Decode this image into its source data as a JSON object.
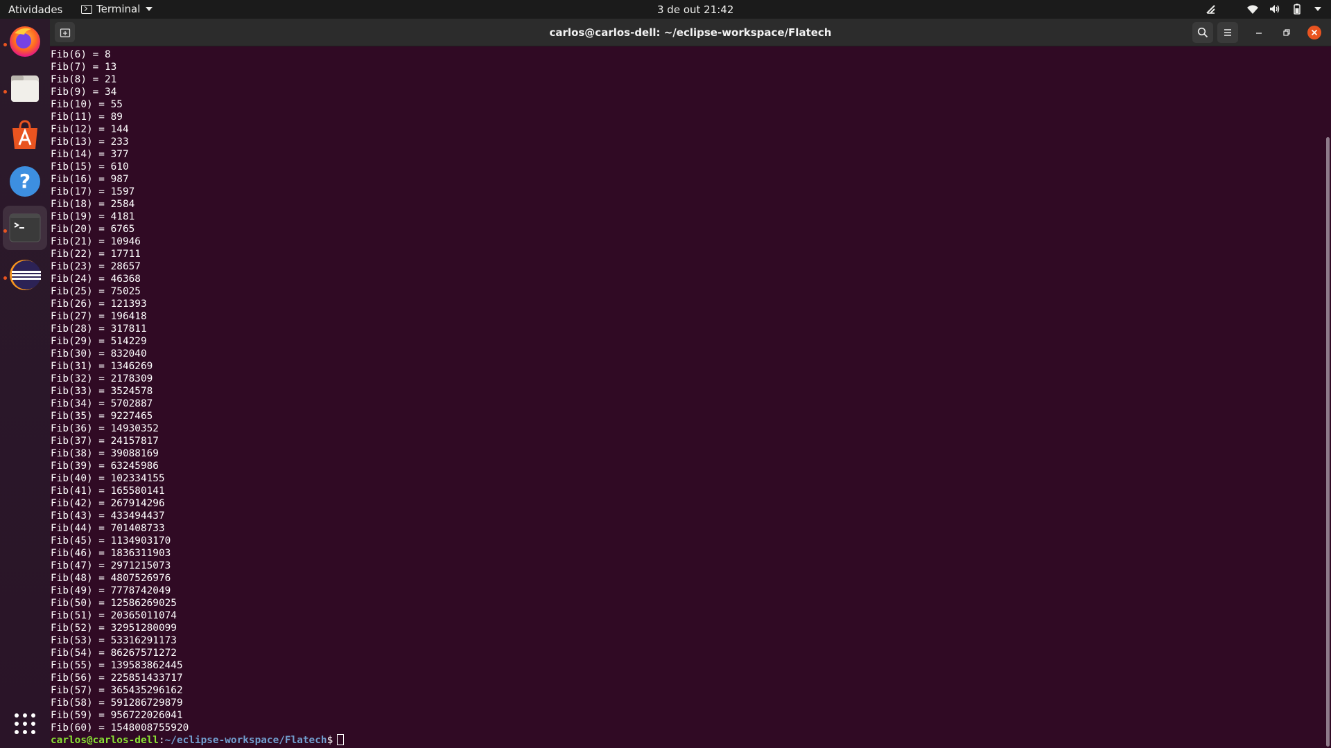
{
  "topbar": {
    "activities": "Atividades",
    "app_name": "Terminal",
    "clock": "3 de out  21:42"
  },
  "dock": {
    "items": [
      {
        "name": "firefox-icon",
        "active": false,
        "running": true
      },
      {
        "name": "files-icon",
        "active": false,
        "running": true
      },
      {
        "name": "software-icon",
        "active": false,
        "running": false
      },
      {
        "name": "help-icon",
        "active": false,
        "running": false
      },
      {
        "name": "terminal-icon",
        "active": true,
        "running": true
      },
      {
        "name": "eclipse-icon",
        "active": false,
        "running": true
      }
    ]
  },
  "window": {
    "title": "carlos@carlos-dell: ~/eclipse-workspace/Flatech"
  },
  "terminal": {
    "lines": [
      "Fib(6) = 8",
      "Fib(7) = 13",
      "Fib(8) = 21",
      "Fib(9) = 34",
      "Fib(10) = 55",
      "Fib(11) = 89",
      "Fib(12) = 144",
      "Fib(13) = 233",
      "Fib(14) = 377",
      "Fib(15) = 610",
      "Fib(16) = 987",
      "Fib(17) = 1597",
      "Fib(18) = 2584",
      "Fib(19) = 4181",
      "Fib(20) = 6765",
      "Fib(21) = 10946",
      "Fib(22) = 17711",
      "Fib(23) = 28657",
      "Fib(24) = 46368",
      "Fib(25) = 75025",
      "Fib(26) = 121393",
      "Fib(27) = 196418",
      "Fib(28) = 317811",
      "Fib(29) = 514229",
      "Fib(30) = 832040",
      "Fib(31) = 1346269",
      "Fib(32) = 2178309",
      "Fib(33) = 3524578",
      "Fib(34) = 5702887",
      "Fib(35) = 9227465",
      "Fib(36) = 14930352",
      "Fib(37) = 24157817",
      "Fib(38) = 39088169",
      "Fib(39) = 63245986",
      "Fib(40) = 102334155",
      "Fib(41) = 165580141",
      "Fib(42) = 267914296",
      "Fib(43) = 433494437",
      "Fib(44) = 701408733",
      "Fib(45) = 1134903170",
      "Fib(46) = 1836311903",
      "Fib(47) = 2971215073",
      "Fib(48) = 4807526976",
      "Fib(49) = 7778742049",
      "Fib(50) = 12586269025",
      "Fib(51) = 20365011074",
      "Fib(52) = 32951280099",
      "Fib(53) = 53316291173",
      "Fib(54) = 86267571272",
      "Fib(55) = 139583862445",
      "Fib(56) = 225851433717",
      "Fib(57) = 365435296162",
      "Fib(58) = 591286729879",
      "Fib(59) = 956722026041",
      "Fib(60) = 1548008755920"
    ],
    "prompt": {
      "user_host": "carlos@carlos-dell",
      "separator": ":",
      "path": "~/eclipse-workspace/Flatech",
      "symbol": "$"
    }
  },
  "colors": {
    "terminal_bg": "#300a24",
    "prompt_user": "#8ae234",
    "prompt_path": "#729fcf",
    "close_button": "#e95420"
  }
}
